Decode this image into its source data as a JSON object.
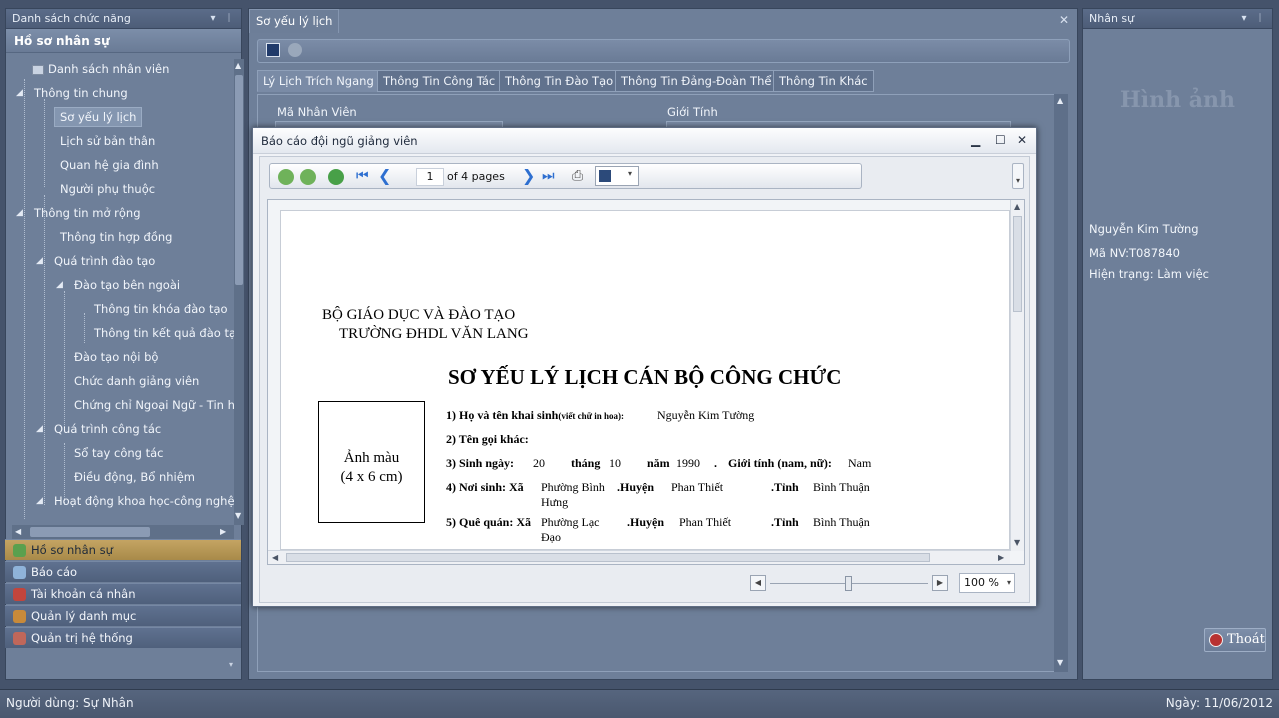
{
  "left_panel": {
    "header": "Danh sách chức năng",
    "group_title": "Hồ sơ nhân sự",
    "tree": [
      {
        "label": "Danh sách nhân viên"
      },
      {
        "label": "Thông tin chung"
      },
      {
        "label": "Sơ yếu lý lịch"
      },
      {
        "label": "Lịch sử bản thân"
      },
      {
        "label": "Quan hệ gia đình"
      },
      {
        "label": "Người phụ thuộc"
      },
      {
        "label": "Thông tin mở rộng"
      },
      {
        "label": "Thông tin hợp đồng"
      },
      {
        "label": "Quá trình đào tạo"
      },
      {
        "label": "Đào tạo bên ngoài"
      },
      {
        "label": "Thông tin khóa đào tạo"
      },
      {
        "label": "Thông tin kết quả đào tạ"
      },
      {
        "label": "Đào tạo nội bộ"
      },
      {
        "label": "Chức danh giảng viên"
      },
      {
        "label": "Chứng chỉ Ngoại Ngữ - Tin h"
      },
      {
        "label": "Quá trình công tác"
      },
      {
        "label": "Sổ tay công tác"
      },
      {
        "label": "Điều động, Bổ nhiệm"
      },
      {
        "label": "Hoạt động khoa học-công nghệ"
      }
    ],
    "nav": [
      {
        "label": "Hồ sơ nhân sự"
      },
      {
        "label": "Báo cáo"
      },
      {
        "label": "Tài khoản cá nhân"
      },
      {
        "label": "Quản lý danh mục"
      },
      {
        "label": "Quản trị hệ thống"
      }
    ]
  },
  "center": {
    "doc_tab": "Sơ yếu lý lịch",
    "subtabs": [
      {
        "label": "Lý Lịch Trích Ngang"
      },
      {
        "label": "Thông Tin Công Tác"
      },
      {
        "label": "Thông Tin Đào Tạo"
      },
      {
        "label": "Thông Tin Đảng-Đoàn Thể"
      },
      {
        "label": "Thông Tin Khác"
      }
    ],
    "fields": {
      "employee_id_label": "Mã Nhân Viên",
      "gender_label": "Giới Tính"
    }
  },
  "right_panel": {
    "header": "Nhân sự",
    "photo_placeholder": "Hình ảnh",
    "name": "Nguyễn Kim Tường",
    "employee_code": "Mã NV:T087840",
    "status": "Hiện trạng: Làm việc",
    "exit_label": "Thoát"
  },
  "dialog": {
    "title": "Báo cáo đội ngũ giảng viên",
    "page_number": "1",
    "page_total_text": "of 4 pages",
    "zoom": "100 %",
    "report": {
      "ministry": "BỘ GIÁO DỤC VÀ ĐÀO TẠO",
      "school": "TRƯỜNG ĐHDL VĂN LANG",
      "title": "SƠ YẾU LÝ LỊCH CÁN BỘ CÔNG CHỨC",
      "photo_line1": "Ảnh màu",
      "photo_line2": "(4 x 6 cm)",
      "q1_label": "1) Họ và tên khai sinh",
      "q1_note": "(viết chữ in hoa):",
      "q1_value": "Nguyễn Kim Tường",
      "q2_label": "2) Tên gọi khác:",
      "q3_label": "3) Sinh ngày:",
      "q3_day": "20",
      "q3_month_label": "tháng",
      "q3_month": "10",
      "q3_year_label": "năm",
      "q3_year": "1990",
      "q3_dot": ".",
      "q3_gender_label": "Giới tính (nam, nữ):",
      "q3_gender": "Nam",
      "q4_label": "4) Nơi sinh: Xã",
      "q4_commune_1": "Phường Bình",
      "q4_commune_2": "Hưng",
      "q4_district_label": ".Huyện",
      "q4_district": "Phan Thiết",
      "q4_province_label": ".Tỉnh",
      "q4_province": "Bình Thuận",
      "q5_label": "5) Quê quán: Xã",
      "q5_commune_1": "Phường Lạc",
      "q5_commune_2": "Đạo",
      "q5_district_label": ".Huyện",
      "q5_district": "Phan Thiết",
      "q5_province_label": ".Tỉnh",
      "q5_province": "Bình Thuận"
    }
  },
  "status_bar": {
    "user": "Người dùng: Sự Nhân",
    "date": "Ngày: 11/06/2012"
  }
}
